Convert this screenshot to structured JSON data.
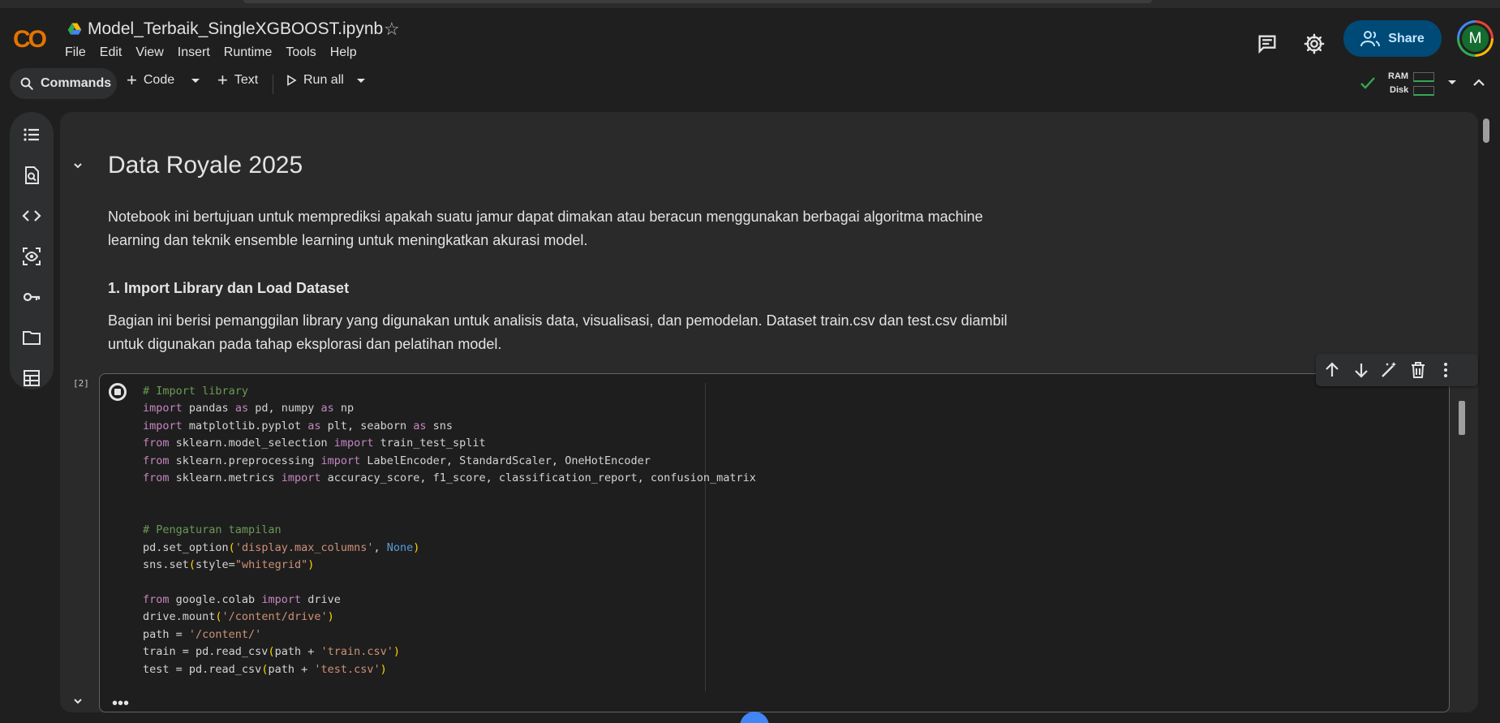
{
  "app": {
    "logo_text": "CO",
    "title": "Model_Terbaik_SingleXGBOOST.ipynb",
    "menu": [
      "File",
      "Edit",
      "View",
      "Insert",
      "Runtime",
      "Tools",
      "Help"
    ],
    "share_label": "Share",
    "avatar_letter": "M"
  },
  "toolbar": {
    "commands_label": "Commands",
    "code_label": "Code",
    "text_label": "Text",
    "run_all_label": "Run all",
    "ram_label": "RAM",
    "disk_label": "Disk"
  },
  "sidebar": {
    "items": [
      "table-of-contents-icon",
      "find-replace-icon",
      "code-snippets-icon",
      "variables-icon",
      "secrets-key-icon",
      "files-folder-icon",
      "data-table-icon"
    ]
  },
  "notebook": {
    "heading": "Data Royale 2025",
    "intro_line1": "Notebook ini bertujuan untuk memprediksi apakah suatu jamur dapat dimakan atau beracun menggunakan berbagai algoritma machine",
    "intro_line2": "learning dan teknik ensemble learning untuk meningkatkan akurasi model.",
    "section_heading": "1. Import Library dan Load Dataset",
    "section_line1": "Bagian ini berisi pemanggilan library yang digunakan untuk analisis data, visualisasi, dan pemodelan. Dataset train.csv dan test.csv diambil",
    "section_line2": "untuk digunakan pada tahap eksplorasi dan pelatihan model.",
    "exec_count": "[2]",
    "code_lines": [
      "# Import library",
      "import pandas as pd, numpy as np",
      "import matplotlib.pyplot as plt, seaborn as sns",
      "from sklearn.model_selection import train_test_split",
      "from sklearn.preprocessing import LabelEncoder, StandardScaler, OneHotEncoder",
      "from sklearn.metrics import accuracy_score, f1_score, classification_report, confusion_matrix",
      "",
      "",
      "# Pengaturan tampilan",
      "pd.set_option('display.max_columns', None)",
      "sns.set(style=\"whitegrid\")",
      "",
      "from google.colab import drive",
      "drive.mount('/content/drive')",
      "path = '/content/'",
      "train = pd.read_csv(path + 'train.csv')",
      "test = pd.read_csv(path + 'test.csv')"
    ],
    "more_label": "•••"
  },
  "colors": {
    "accent": "#004a77",
    "share_text": "#c2e7ff",
    "logo_orange": "#f9ab00",
    "status_green": "#34a853"
  }
}
